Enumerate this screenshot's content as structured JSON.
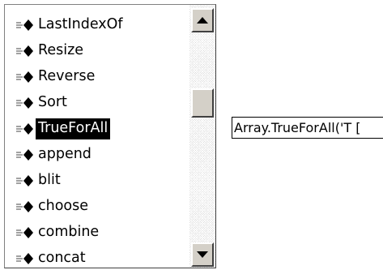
{
  "completion_list": {
    "items": [
      {
        "label": "LastIndexOf",
        "icon": "method-icon"
      },
      {
        "label": "Resize",
        "icon": "method-icon"
      },
      {
        "label": "Reverse",
        "icon": "method-icon"
      },
      {
        "label": "Sort",
        "icon": "method-icon"
      },
      {
        "label": "TrueForAll",
        "icon": "method-icon",
        "selected": true
      },
      {
        "label": "append",
        "icon": "method-icon"
      },
      {
        "label": "blit",
        "icon": "method-icon"
      },
      {
        "label": "choose",
        "icon": "method-icon"
      },
      {
        "label": "combine",
        "icon": "method-icon"
      },
      {
        "label": "concat",
        "icon": "method-icon"
      }
    ],
    "selected_index": 4
  },
  "tooltip": {
    "text": "Array.TrueForAll('T ["
  },
  "colors": {
    "selection_bg": "#000000",
    "selection_fg": "#ffffff",
    "icon": "#000000",
    "scrollbar_face": "#d4d0c8"
  }
}
